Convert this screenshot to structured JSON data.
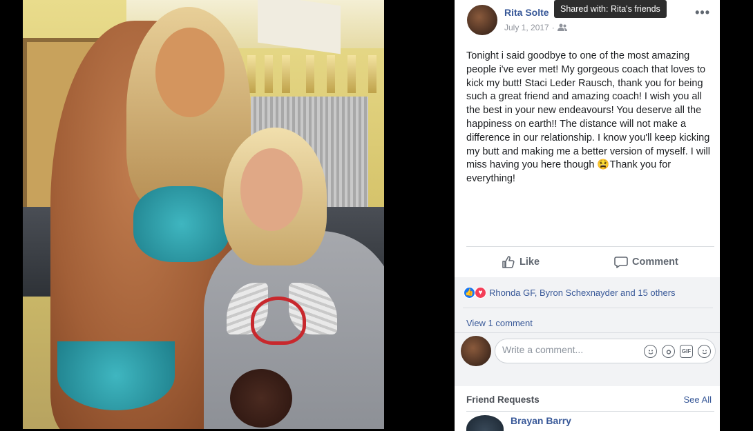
{
  "post": {
    "author": "Rita Solte",
    "date": "July 1, 2017",
    "date_separator": "·",
    "tooltip": "Shared with: Rita's friends",
    "text": "Tonight i said goodbye to one of the most amazing people i've ever met! My gorgeous coach that loves to kick my butt! Staci Leder Rausch, thank you for being such a great friend and amazing coach! I wish you all the best in your new endeavours! You deserve all the happiness on earth!! The distance will not make a difference in our relationship. I know you'll keep kicking my butt and making me a better version of myself. I will miss having you here though 😫Thank you for everything!"
  },
  "actions": {
    "like_label": "Like",
    "comment_label": "Comment"
  },
  "reactions": {
    "summary": "Rhonda GF, Byron Schexnayder and 15 others"
  },
  "comments": {
    "view_label": "View 1 comment",
    "input_placeholder": "Write a comment..."
  },
  "composer_icons": [
    "emoji-icon",
    "camera-icon",
    "gif-icon",
    "sticker-icon"
  ],
  "friend_requests": {
    "title": "Friend Requests",
    "see_all": "See All",
    "first_name": "Brayan Barry"
  },
  "colors": {
    "link": "#385898",
    "muted": "#606770",
    "reaction_like": "#1877f2",
    "reaction_love": "#f33e58"
  }
}
